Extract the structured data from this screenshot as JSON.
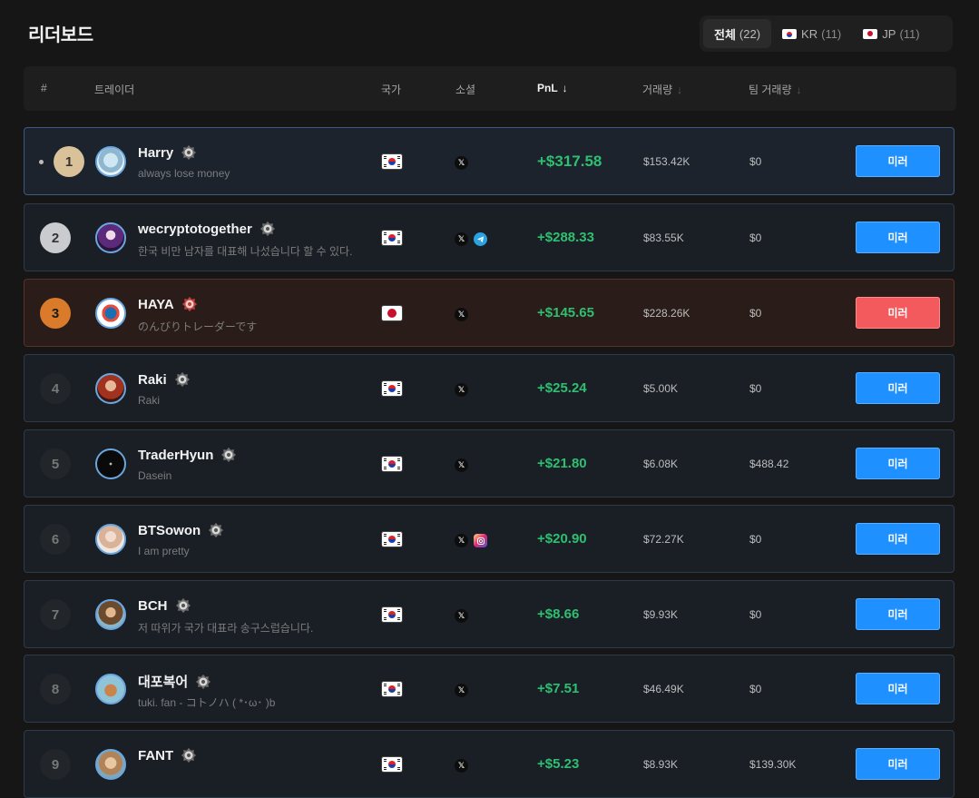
{
  "page_title": "리더보드",
  "tabs": [
    {
      "label": "전체",
      "count": "(22)"
    },
    {
      "label": "KR",
      "count": "(11)"
    },
    {
      "label": "JP",
      "count": "(11)"
    }
  ],
  "columns": {
    "rank": "#",
    "trader": "트레이더",
    "country": "국가",
    "social": "소셜",
    "pnl": "PnL",
    "volume": "거래량",
    "team_volume": "팀 거래량",
    "sort_arrow": "↓"
  },
  "rows": [
    {
      "rank": "1",
      "name": "Harry",
      "bio": "always lose money",
      "country": "KR",
      "socials": [
        "x"
      ],
      "pnl": "+$317.58",
      "volume": "$153.42K",
      "team_volume": "$0",
      "action": "미러",
      "action_color": "#1e90ff"
    },
    {
      "rank": "2",
      "name": "wecryptotogether",
      "bio": "한국 비만 남자를 대표해 나섰습니다 할 수 있다.",
      "country": "KR",
      "socials": [
        "x",
        "telegram"
      ],
      "pnl": "+$288.33",
      "volume": "$83.55K",
      "team_volume": "$0",
      "action": "미러",
      "action_color": "#1e90ff"
    },
    {
      "rank": "3",
      "name": "HAYA",
      "bio": "のんびりトレーダーです",
      "country": "JP",
      "socials": [
        "x"
      ],
      "pnl": "+$145.65",
      "volume": "$228.26K",
      "team_volume": "$0",
      "action": "미러",
      "action_color": "#f25a5e"
    },
    {
      "rank": "4",
      "name": "Raki",
      "bio": "Raki",
      "country": "KR",
      "socials": [
        "x"
      ],
      "pnl": "+$25.24",
      "volume": "$5.00K",
      "team_volume": "$0",
      "action": "미러",
      "action_color": "#1e90ff"
    },
    {
      "rank": "5",
      "name": "TraderHyun",
      "bio": "Dasein",
      "country": "KR",
      "socials": [
        "x"
      ],
      "pnl": "+$21.80",
      "volume": "$6.08K",
      "team_volume": "$488.42",
      "action": "미러",
      "action_color": "#1e90ff"
    },
    {
      "rank": "6",
      "name": "BTSowon",
      "bio": "I am pretty",
      "country": "KR",
      "socials": [
        "x",
        "instagram"
      ],
      "pnl": "+$20.90",
      "volume": "$72.27K",
      "team_volume": "$0",
      "action": "미러",
      "action_color": "#1e90ff"
    },
    {
      "rank": "7",
      "name": "BCH",
      "bio": "저 따위가 국가 대표라 송구스럽습니다.",
      "country": "KR",
      "socials": [
        "x"
      ],
      "pnl": "+$8.66",
      "volume": "$9.93K",
      "team_volume": "$0",
      "action": "미러",
      "action_color": "#1e90ff"
    },
    {
      "rank": "8",
      "name": "대포복어",
      "bio": "tuki. fan - コトノハ ( *･ω･ )b",
      "country": "KR",
      "socials": [
        "x"
      ],
      "pnl": "+$7.51",
      "volume": "$46.49K",
      "team_volume": "$0",
      "action": "미러",
      "action_color": "#1e90ff"
    },
    {
      "rank": "9",
      "name": "FANT",
      "bio": "",
      "country": "KR",
      "socials": [
        "x"
      ],
      "pnl": "+$5.23",
      "volume": "$8.93K",
      "team_volume": "$139.30K",
      "action": "미러",
      "action_color": "#1e90ff"
    }
  ],
  "colors": {
    "background": "#161616",
    "positive_pnl": "#2fbf71",
    "mirror_button": "#1e90ff",
    "mirror_button_jp": "#f25a5e",
    "gold": "#d9c19a",
    "silver": "#c9cbcf",
    "bronze": "#d97b2a"
  }
}
